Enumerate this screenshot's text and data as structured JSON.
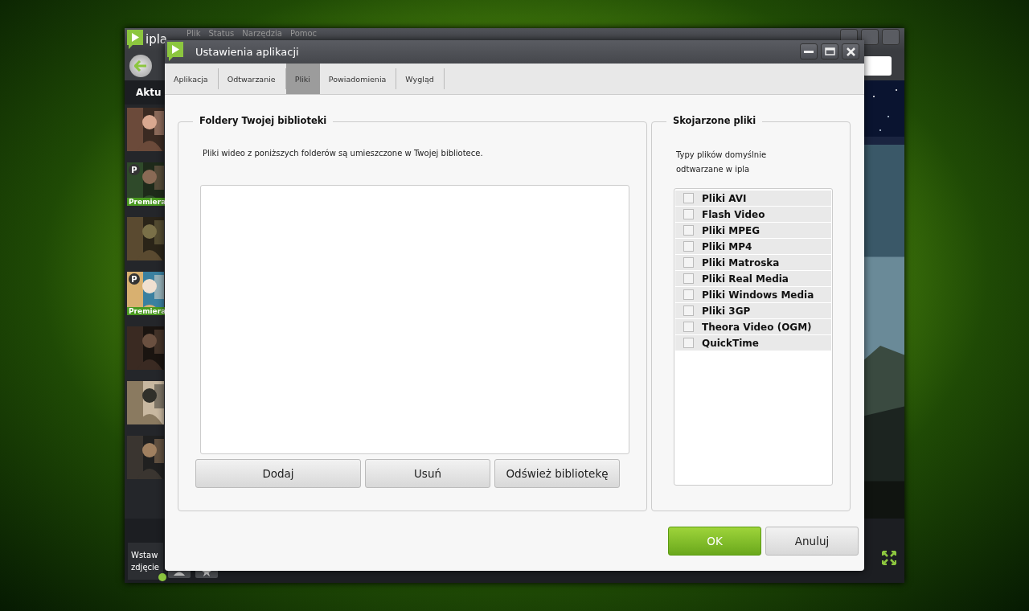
{
  "app": {
    "logo": "ipla",
    "menu": [
      "Plik",
      "Status",
      "Narzędzia",
      "Pomoc"
    ],
    "sidebar": {
      "heading": "Aktu",
      "items": [
        {
          "kind": "picture"
        },
        {
          "kind": "picture",
          "badge": "P",
          "label": "Premiera"
        },
        {
          "kind": "picture"
        },
        {
          "kind": "picture",
          "badge": "P",
          "label": "Premiera"
        },
        {
          "kind": "picture"
        },
        {
          "kind": "picture"
        },
        {
          "kind": "picture"
        }
      ]
    },
    "insert_photo": "Wstaw zdjęcie"
  },
  "dialog": {
    "title": "Ustawienia aplikacji",
    "tabs": [
      {
        "label": "Aplikacja",
        "selected": false
      },
      {
        "label": "Odtwarzanie",
        "selected": false
      },
      {
        "label": "Pliki",
        "selected": true
      },
      {
        "label": "Powiadomienia",
        "selected": false
      },
      {
        "label": "Wygląd",
        "selected": false
      }
    ],
    "library": {
      "legend": "Foldery Twojej biblioteki",
      "description": "Pliki wideo z poniższych folderów są umieszczone w Twojej bibliotece.",
      "buttons": [
        "Dodaj",
        "Usuń",
        "Odśwież bibliotekę"
      ]
    },
    "associations": {
      "legend": "Skojarzone pliki",
      "description": "Typy plików domyślnie odtwarzane w ipla",
      "items": [
        {
          "label": "Pliki AVI",
          "checked": false
        },
        {
          "label": "Flash Video",
          "checked": false
        },
        {
          "label": "Pliki MPEG",
          "checked": false
        },
        {
          "label": "Pliki MP4",
          "checked": false
        },
        {
          "label": "Pliki Matroska",
          "checked": false
        },
        {
          "label": "Pliki Real Media",
          "checked": false
        },
        {
          "label": "Pliki Windows Media",
          "checked": false
        },
        {
          "label": "Pliki 3GP",
          "checked": false
        },
        {
          "label": "Theora Video (OGM)",
          "checked": false
        },
        {
          "label": "QuickTime",
          "checked": false
        }
      ]
    },
    "ok": "OK",
    "cancel": "Anuluj"
  }
}
